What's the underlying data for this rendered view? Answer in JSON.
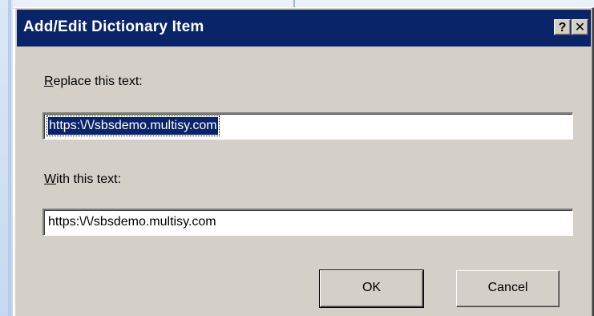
{
  "dialog": {
    "title": "Add/Edit Dictionary Item",
    "help_label": "?",
    "close_label": "✕",
    "replace_label_accel": "R",
    "replace_label_rest": "eplace this text:",
    "replace_value": "https:\\/\\/sbsdemo.multisy.com",
    "with_label_accel": "W",
    "with_label_rest": "ith this text:",
    "with_value": "https:\\/\\/sbsdemo.multisy.com",
    "ok_label": "OK",
    "cancel_label": "Cancel"
  },
  "colors": {
    "titlebar": "#0a246a",
    "dialog_face": "#d4d0c8",
    "selection": "#0a246a"
  },
  "icons": {
    "help": "help-icon",
    "close": "close-icon"
  }
}
